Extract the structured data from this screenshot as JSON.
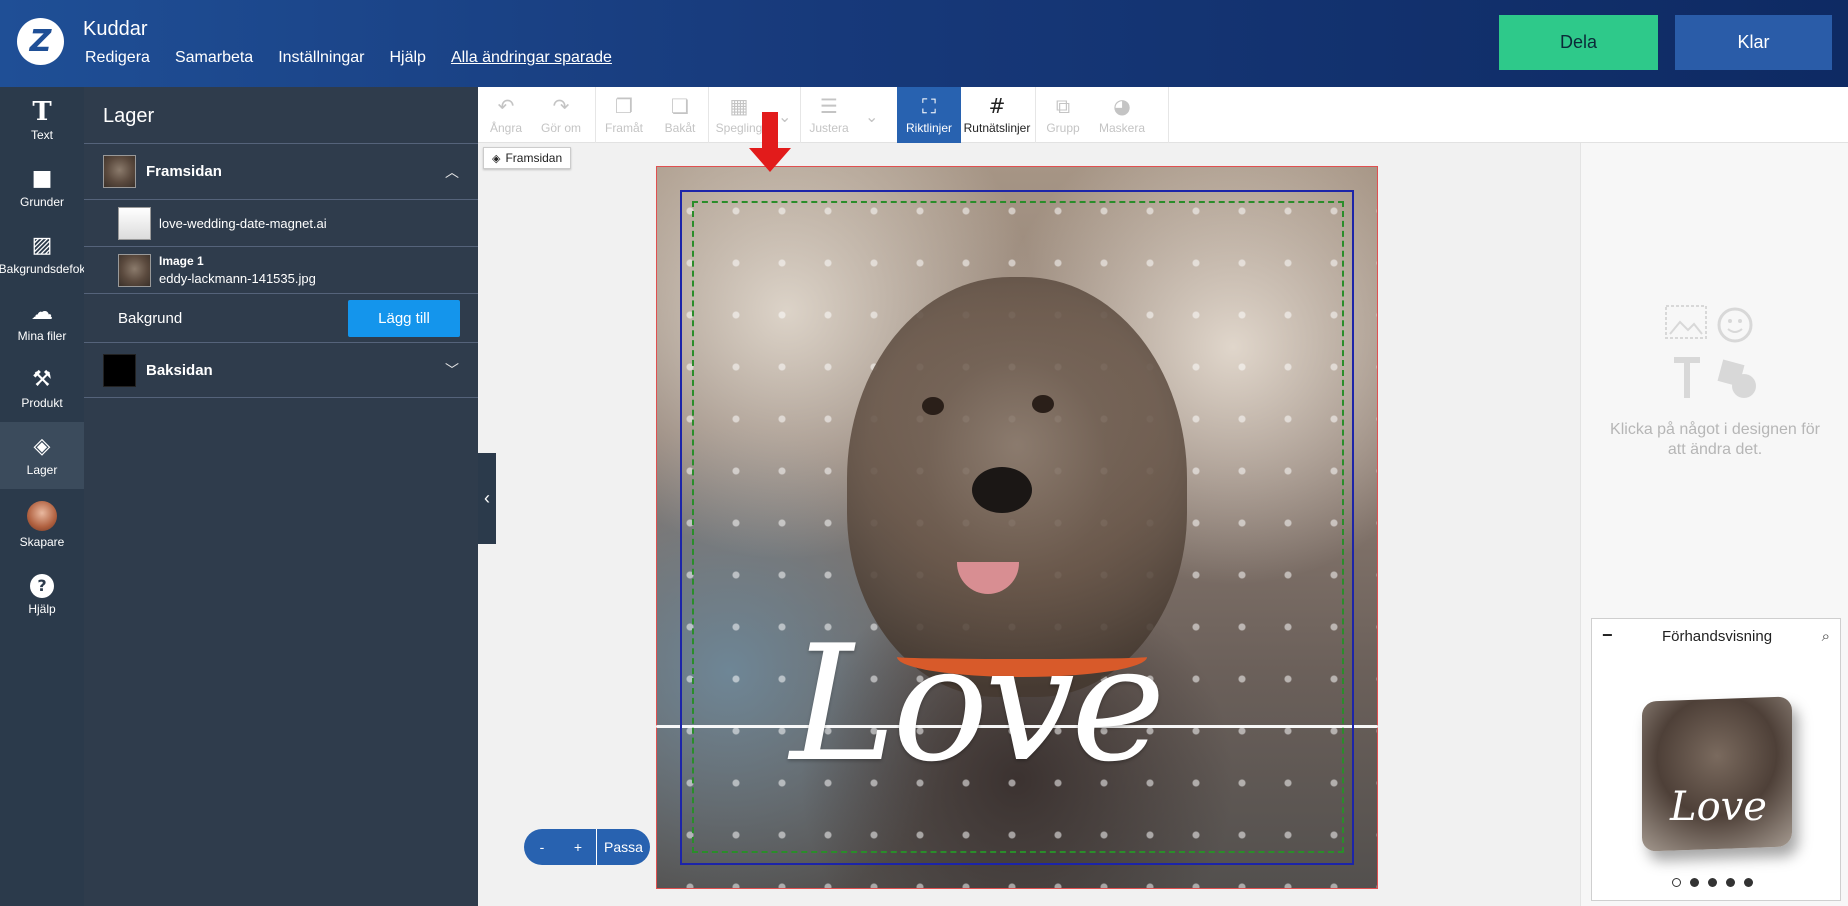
{
  "header": {
    "logo_glyph": "Z",
    "title": "Kuddar",
    "menu": [
      "Redigera",
      "Samarbeta",
      "Inställningar",
      "Hjälp"
    ],
    "save_status": "Alla ändringar sparade",
    "share_label": "Dela",
    "done_label": "Klar"
  },
  "rail": {
    "items": [
      {
        "label": "Text",
        "icon": "text-icon"
      },
      {
        "label": "Grunder",
        "icon": "shapes-icon"
      },
      {
        "label": "Bakgrundsdefok",
        "icon": "hatch-icon"
      },
      {
        "label": "Mina filer",
        "icon": "cloud-upload-icon"
      },
      {
        "label": "Produkt",
        "icon": "product-icon"
      },
      {
        "label": "Lager",
        "icon": "layers-icon"
      },
      {
        "label": "Skapare",
        "icon": "avatar"
      },
      {
        "label": "Hjälp",
        "icon": "help-icon"
      }
    ]
  },
  "layers": {
    "title": "Lager",
    "front": {
      "label": "Framsidan"
    },
    "items": [
      {
        "name": "love-wedding-date-magnet.ai"
      },
      {
        "title": "Image 1",
        "name": "eddy-lackmann-141535.jpg"
      }
    ],
    "background_label": "Bakgrund",
    "add_label": "Lägg till",
    "back": {
      "label": "Baksidan"
    }
  },
  "toolbar": {
    "tools": [
      "Ångra",
      "Gör om",
      "Framåt",
      "Bakåt",
      "Spegling",
      "Justera",
      "Riktlinjer",
      "Rutnätslinjer",
      "Grupp",
      "Maskera"
    ]
  },
  "canvas": {
    "side_tag": "Framsidan",
    "design_text": "Love"
  },
  "zoom": {
    "minus": "-",
    "plus": "+",
    "fit": "Passa"
  },
  "right": {
    "hint": "Klicka på något i designen för att ändra det."
  },
  "preview": {
    "minus": "−",
    "title": "Förhandsvisning",
    "pillow_text": "Love",
    "dots": 5
  },
  "colors": {
    "header": "#1f4f96",
    "share": "#2ec98a",
    "done": "#2a5ca8",
    "add": "#1495ec",
    "active_tool": "#2862b0",
    "arrow": "#e21b1b"
  }
}
